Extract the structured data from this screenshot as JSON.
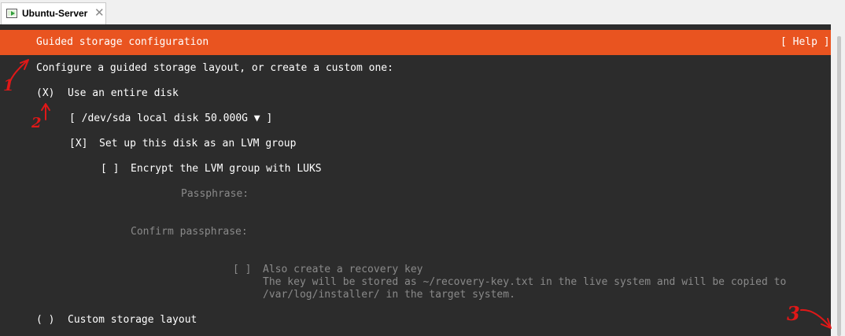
{
  "window": {
    "tab_title": "Ubuntu-Server",
    "tab_close": "✕"
  },
  "installer": {
    "header_title": "Guided storage configuration",
    "help_button": "[ Help ]",
    "intro": "Configure a guided storage layout, or create a custom one:",
    "entire_disk": {
      "radio": "(X)",
      "label": "Use an entire disk"
    },
    "disk_select": {
      "text": "[ /dev/sda local disk 50.000G ▼ ]"
    },
    "lvm": {
      "checkbox": "[X]",
      "label": "Set up this disk as an LVM group"
    },
    "encrypt": {
      "checkbox": "[ ]",
      "label": "Encrypt the LVM group with LUKS"
    },
    "passphrase_label": "Passphrase:",
    "confirm_label": "Confirm passphrase:",
    "recovery": {
      "checkbox": "[ ]",
      "label": "Also create a recovery key",
      "desc_line1": "The key will be stored as ~/recovery-key.txt in the live system and will be copied to",
      "desc_line2": "/var/log/installer/ in the target system."
    },
    "custom": {
      "radio": "( )",
      "label": "Custom storage layout"
    }
  },
  "annotations": {
    "label_1": "1",
    "label_2": "2",
    "label_3": "3"
  },
  "colors": {
    "accent": "#e95420",
    "terminal_bg": "#2c2c2c",
    "annotation": "#e01818"
  },
  "icons": {
    "tab": "virtualbox-vm-icon"
  }
}
